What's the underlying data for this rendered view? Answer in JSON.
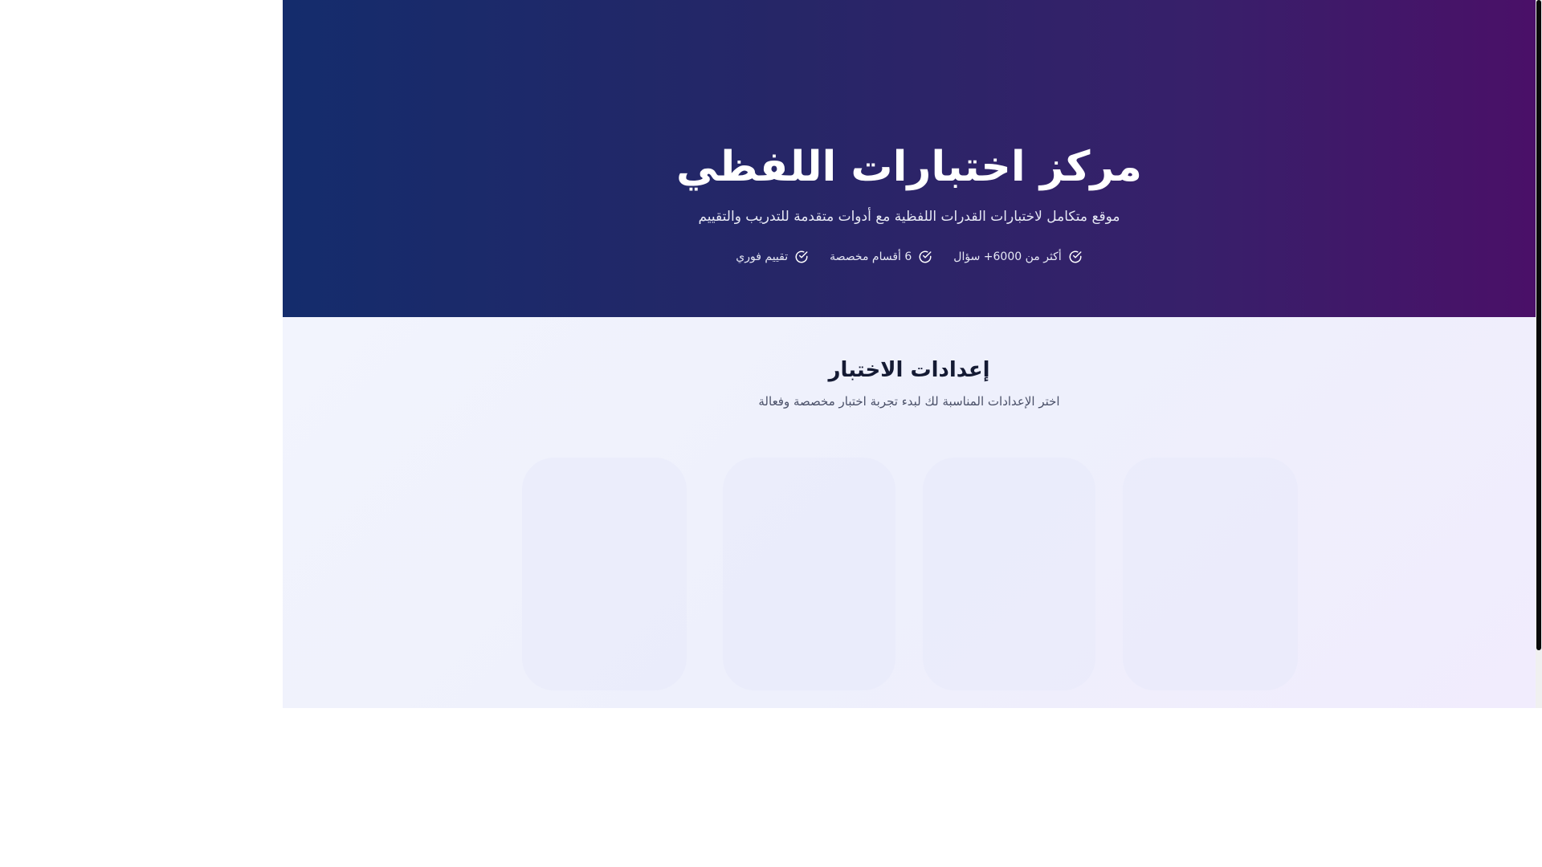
{
  "hero": {
    "title": "مركز اختبارات اللفظي",
    "subtitle": "موقع متكامل لاختبارات القدرات اللفظية مع أدوات متقدمة للتدريب والتقييم",
    "features": [
      {
        "label": "أكثر من 6000+ سؤال",
        "icon": "check-circle-icon"
      },
      {
        "label": "6 أقسام مخصصة",
        "icon": "check-circle-icon"
      },
      {
        "label": "تقييم فوري",
        "icon": "check-circle-icon"
      }
    ],
    "colors": {
      "gradient_start": "#142c6c",
      "gradient_end": "#4a1068",
      "text": "#ffffff"
    }
  },
  "settings": {
    "title": "إعدادات الاختبار",
    "subtitle": "اختر الإعدادات المناسبة لك لبدء تجربة اختبار مخصصة وفعالة"
  }
}
